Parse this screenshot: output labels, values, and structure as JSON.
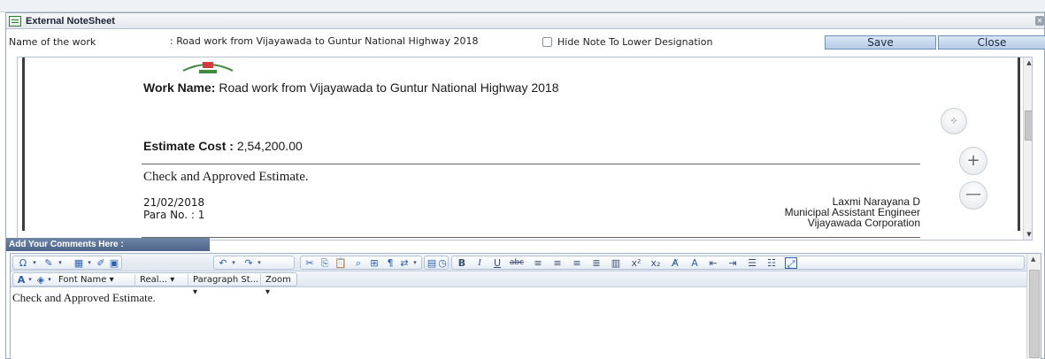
{
  "window": {
    "title": "External NoteSheet"
  },
  "info": {
    "name_label": "Name of the work",
    "name_value": ": Road work from Vijayawada to Guntur National Highway 2018",
    "hide_note_label": "Hide Note To Lower Designation",
    "hide_note_checked": false,
    "save_label": "Save",
    "close_label": "Close"
  },
  "preview": {
    "work_name_label": "Work Name:",
    "work_name_value": "Road work from Vijayawada to Guntur National Highway 2018",
    "estimate_label": "Estimate Cost :",
    "estimate_value": "2,54,200.00",
    "note": "Check and Approved Estimate.",
    "date": "21/02/2018",
    "para": "Para No. : 1",
    "signatory": {
      "name": "Laxmi Narayana D",
      "designation": "Municipal Assistant Engineer",
      "office": "Vijayawada Corporation"
    },
    "zoom_controls": {
      "fit_icon": "fit-screen-icon",
      "zoom_in_icon": "plus-icon",
      "zoom_out_icon": "minus-icon"
    }
  },
  "comments": {
    "header": "Add Your Comments Here :",
    "body_text": "Check and Approved Estimate.",
    "toolbar_dropdowns": {
      "font_name": "Font Name",
      "font_size": "Real...",
      "paragraph_style": "Paragraph St...",
      "zoom": "Zoom"
    },
    "toolbar_icons": [
      "special-char-icon",
      "format-icon",
      "table-icon",
      "edit-icon",
      "image-icon",
      "undo-icon",
      "redo-icon",
      "cut-icon",
      "copy-icon",
      "paste-icon",
      "find-icon",
      "select-all-icon",
      "show-formatting-icon",
      "insert-icon",
      "form-icon",
      "time-icon",
      "bold-icon",
      "italic-icon",
      "underline-icon",
      "strikethrough-icon",
      "align-left-icon",
      "align-center-icon",
      "align-right-icon",
      "justify-icon",
      "superscript-icon",
      "subscript-icon",
      "clear-format-icon",
      "outdent-icon",
      "indent-icon",
      "ordered-list-icon",
      "bullet-list-icon",
      "fullscreen-icon",
      "font-color-icon",
      "highlight-icon"
    ]
  },
  "colors": {
    "header_accent": "#4d6488",
    "button_fill": "#b7cce8",
    "button_border": "#6d8fb8"
  }
}
